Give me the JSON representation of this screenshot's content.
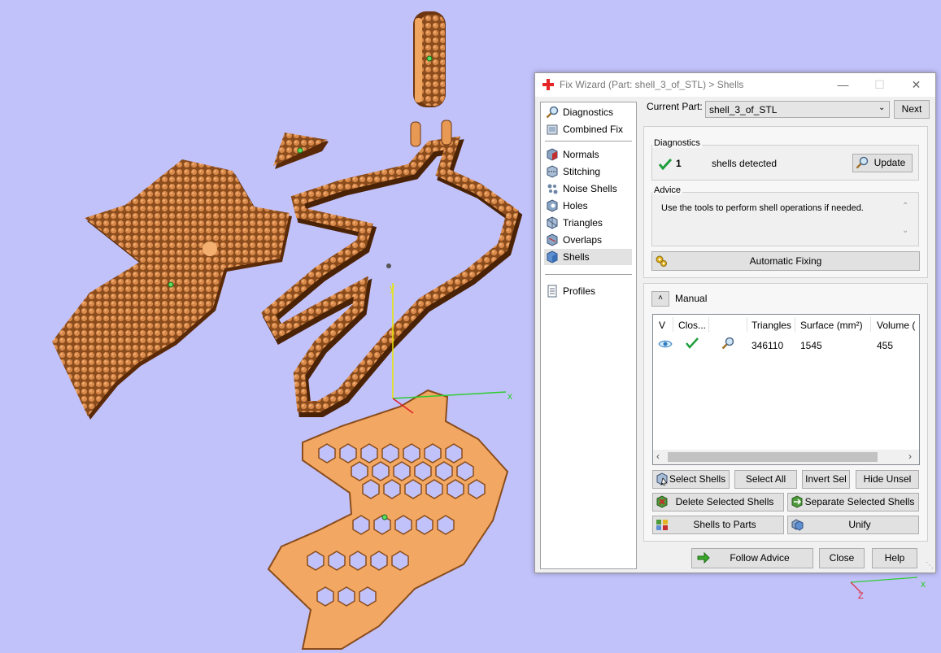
{
  "window": {
    "title": "Fix Wizard (Part: shell_3_of_STL) > Shells",
    "minimize": "—",
    "maximize": "☐",
    "close": "✕"
  },
  "sidebar": {
    "items": [
      {
        "label": "Diagnostics",
        "icon": "magnifier-icon"
      },
      {
        "label": "Combined Fix",
        "icon": "combined-fix-icon"
      },
      {
        "label": "Normals",
        "icon": "normals-icon"
      },
      {
        "label": "Stitching",
        "icon": "stitching-icon"
      },
      {
        "label": "Noise Shells",
        "icon": "noise-shells-icon"
      },
      {
        "label": "Holes",
        "icon": "holes-icon"
      },
      {
        "label": "Triangles",
        "icon": "triangles-icon"
      },
      {
        "label": "Overlaps",
        "icon": "overlaps-icon"
      },
      {
        "label": "Shells",
        "icon": "shells-icon",
        "selected": true
      },
      {
        "label": "Profiles",
        "icon": "profiles-icon"
      }
    ]
  },
  "part": {
    "label": "Current Part:",
    "value": "shell_3_of_STL",
    "next": "Next"
  },
  "diagnostics": {
    "title": "Diagnostics",
    "count": "1",
    "text": "shells detected",
    "update": "Update"
  },
  "advice": {
    "title": "Advice",
    "text": "Use the tools to perform shell operations if needed.",
    "auto_fix": "Automatic Fixing"
  },
  "manual": {
    "title": "Manual",
    "columns": [
      "V",
      "Clos...",
      "Triangles",
      "Surface (mm²)",
      "Volume ("
    ],
    "rows": [
      {
        "triangles": "346110",
        "surface": "1545",
        "volume": "455"
      }
    ],
    "buttons": {
      "select_shells": "Select Shells",
      "select_all": "Select All",
      "invert_sel": "Invert Sel",
      "hide_unsel": "Hide Unsel",
      "delete_selected": "Delete Selected Shells",
      "separate_selected": "Separate Selected Shells",
      "shells_to_parts": "Shells to Parts",
      "unify": "Unify"
    }
  },
  "footer": {
    "follow_advice": "Follow Advice",
    "close": "Close",
    "help": "Help"
  },
  "axes": {
    "x": "x",
    "y": "y",
    "z": "Z"
  },
  "colors": {
    "viewport_bg": "#c2c2fb",
    "model_orange": "#c8763a",
    "model_light": "#f2aa62",
    "x_axis": "#2ecc2e",
    "y_axis": "#e6e600",
    "z_axis": "#e0202a",
    "check_green": "#1e9e3c"
  }
}
